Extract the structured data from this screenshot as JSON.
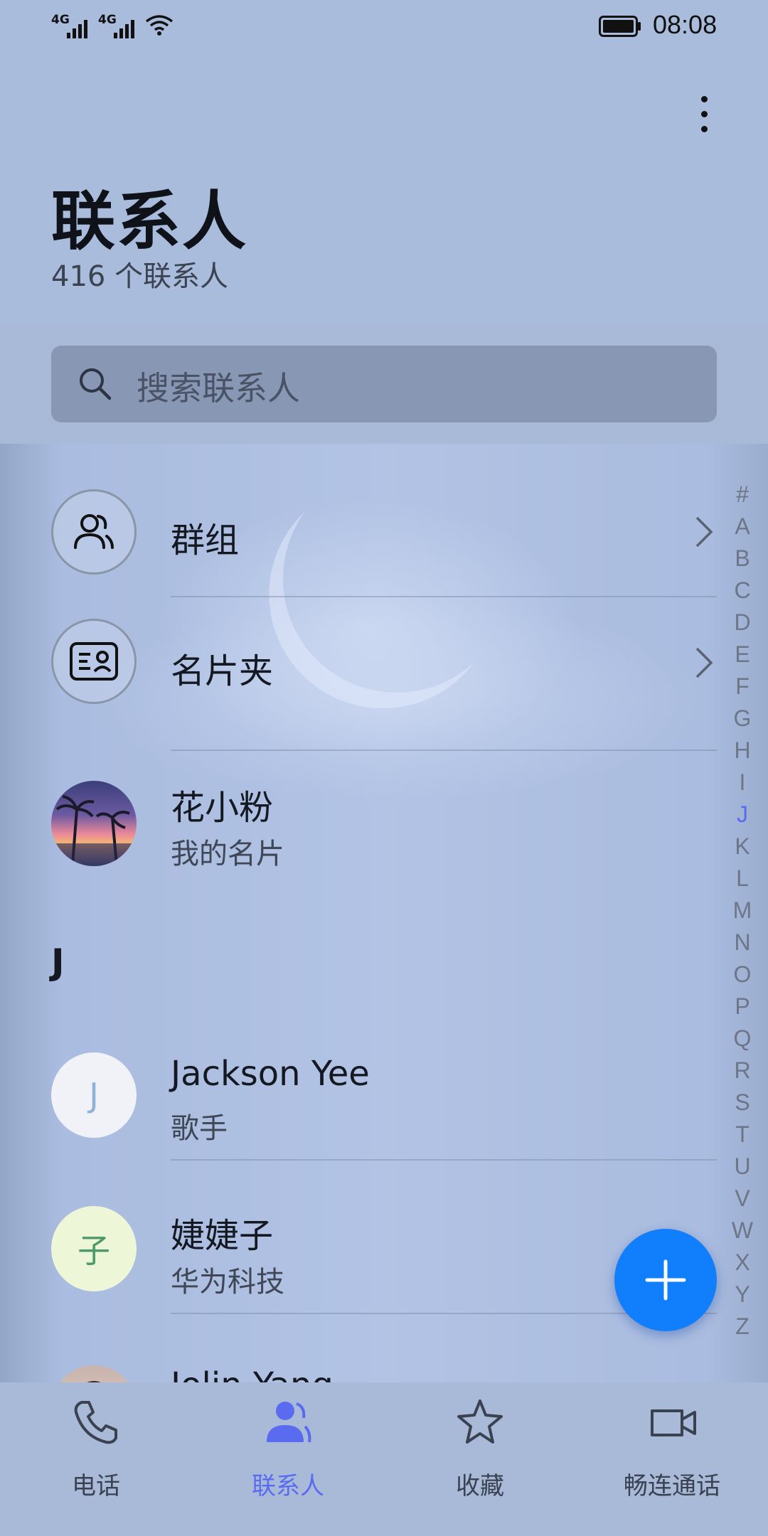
{
  "status_bar": {
    "sim1": "4G",
    "sim2": "4G",
    "time": "08:08"
  },
  "header": {
    "title": "联系人",
    "subtitle": "416 个联系人"
  },
  "search": {
    "placeholder": "搜索联系人"
  },
  "entries": {
    "groups_label": "群组",
    "cards_label": "名片夹"
  },
  "my_card": {
    "name": "花小粉",
    "subtitle": "我的名片"
  },
  "section": {
    "letter": "J"
  },
  "contacts": [
    {
      "name": "Jackson Yee",
      "subtitle": "歌手",
      "avatar_letter": "J",
      "avatar_color": "#f0f2f8",
      "letter_color": "#8fb2d8"
    },
    {
      "name": "婕婕子",
      "subtitle": "华为科技",
      "avatar_letter": "子",
      "avatar_color": "#eef6d8",
      "letter_color": "#4f9a6a"
    },
    {
      "name": "Jolin Yang",
      "subtitle": "",
      "avatar_letter": "",
      "avatar_color": "#d9c8c2",
      "letter_color": "#000000"
    }
  ],
  "alphabet": [
    "#",
    "A",
    "B",
    "C",
    "D",
    "E",
    "F",
    "G",
    "H",
    "I",
    "J",
    "K",
    "L",
    "M",
    "N",
    "O",
    "P",
    "Q",
    "R",
    "S",
    "T",
    "U",
    "V",
    "W",
    "X",
    "Y",
    "Z"
  ],
  "alphabet_active": "J",
  "bottom_nav": {
    "phone": "电话",
    "contacts": "联系人",
    "favorites": "收藏",
    "meetime": "畅连通话"
  },
  "colors": {
    "accent": "#5a6bf0",
    "fab": "#117efc"
  }
}
